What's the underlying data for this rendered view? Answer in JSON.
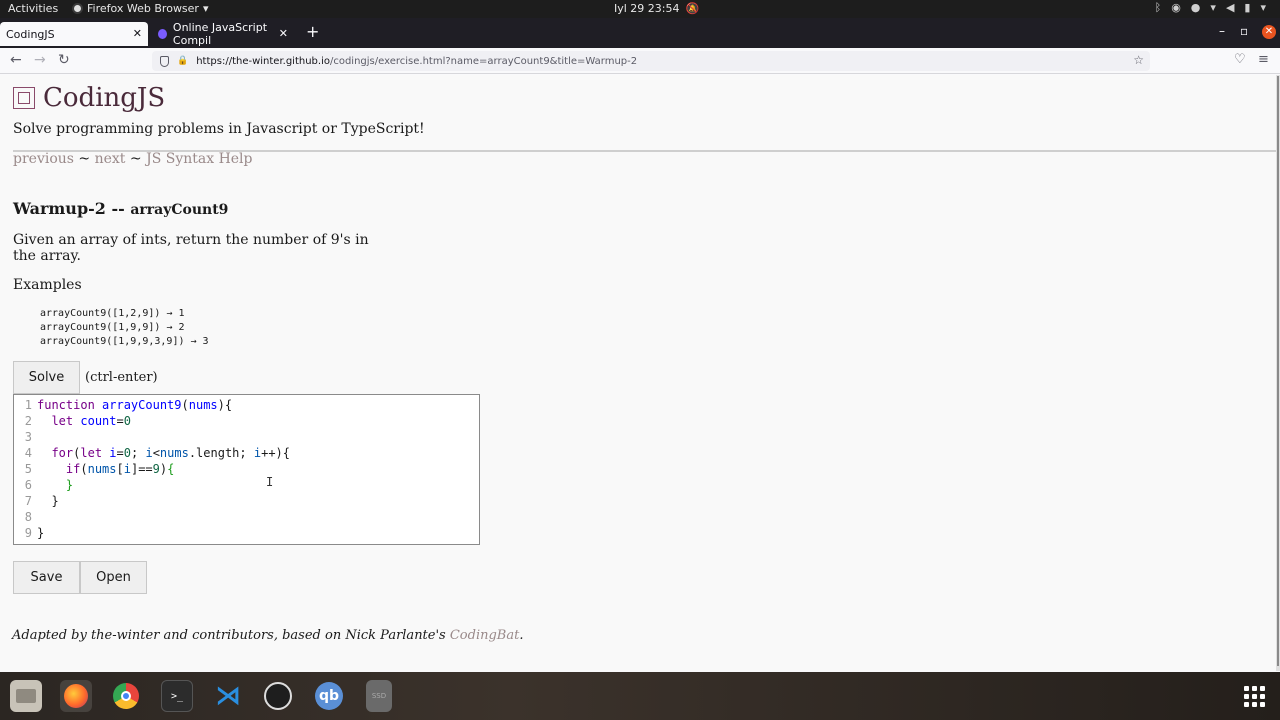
{
  "topbar": {
    "activities": "Activities",
    "app_menu": "Firefox Web Browser",
    "clock": "Iyl 29  23:54"
  },
  "browser": {
    "tabs": [
      {
        "label": "CodingJS",
        "active": true
      },
      {
        "label": "Online JavaScript Compil",
        "active": false
      }
    ],
    "url_host": "https://the-winter.github.io",
    "url_path": "/codingjs/exercise.html?name=arrayCount9&title=Warmup-2"
  },
  "page": {
    "site_title": "CodingJS",
    "tagline": "Solve programming problems in Javascript or TypeScript!",
    "nav": {
      "previous": "previous",
      "sep1": " ~ ",
      "next": "next",
      "sep2": " ~ ",
      "help": "JS Syntax Help"
    },
    "problem": {
      "category": "Warmup-2 -- ",
      "name": "arrayCount9",
      "description": "Given an array of ints, return the number of 9's in the array.",
      "examples_label": "Examples",
      "examples": [
        "arrayCount9([1,2,9]) → 1",
        "arrayCount9([1,9,9]) → 2",
        "arrayCount9([1,9,9,3,9]) → 3"
      ]
    },
    "solve_label": "Solve",
    "solve_hint": "(ctrl-enter)",
    "code_lines": [
      "1",
      "2",
      "3",
      "4",
      "5",
      "6",
      "7",
      "8",
      "9"
    ],
    "save_label": "Save",
    "open_label": "Open",
    "footer": {
      "text": "Adapted by the-winter and contributors, based on Nick Parlante's ",
      "link": "CodingBat",
      "end": "."
    }
  },
  "colors": {
    "link": "#9a8a8a",
    "accent": "#e95420"
  }
}
